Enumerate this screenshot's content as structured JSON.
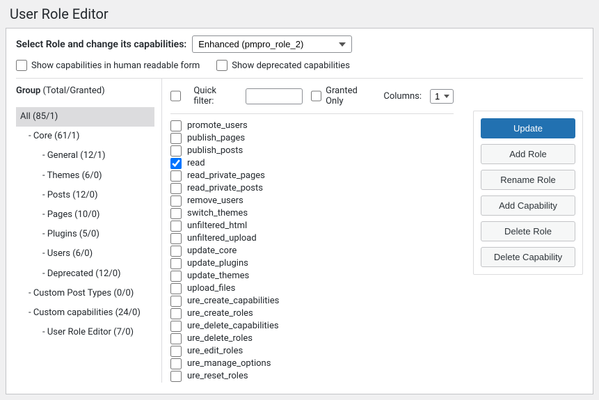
{
  "page_title": "User Role Editor",
  "select_role_label": "Select Role and change its capabilities:",
  "selected_role": "Enhanced (pmpro_role_2)",
  "human_readable_label": "Show capabilities in human readable form",
  "deprecated_label": "Show deprecated capabilities",
  "group_header_bold": "Group",
  "group_header_rest": "(Total/Granted)",
  "quick_filter_label": "Quick filter:",
  "granted_only_label": "Granted Only",
  "columns_label": "Columns:",
  "columns_value": "1",
  "groups": [
    {
      "label": "All (85/1)",
      "level": 0,
      "selected": true
    },
    {
      "label": "- Core (61/1)",
      "level": 1,
      "selected": false
    },
    {
      "label": "- General (12/1)",
      "level": 2,
      "selected": false
    },
    {
      "label": "- Themes (6/0)",
      "level": 2,
      "selected": false
    },
    {
      "label": "- Posts (12/0)",
      "level": 2,
      "selected": false
    },
    {
      "label": "- Pages (10/0)",
      "level": 2,
      "selected": false
    },
    {
      "label": "- Plugins (5/0)",
      "level": 2,
      "selected": false
    },
    {
      "label": "- Users (6/0)",
      "level": 2,
      "selected": false
    },
    {
      "label": "- Deprecated (12/0)",
      "level": 2,
      "selected": false
    },
    {
      "label": "- Custom Post Types (0/0)",
      "level": 1,
      "selected": false
    },
    {
      "label": "- Custom capabilities (24/0)",
      "level": 1,
      "selected": false
    },
    {
      "label": "- User Role Editor (7/0)",
      "level": 2,
      "selected": false
    }
  ],
  "capabilities": [
    {
      "name": "promote_users",
      "checked": false
    },
    {
      "name": "publish_pages",
      "checked": false
    },
    {
      "name": "publish_posts",
      "checked": false
    },
    {
      "name": "read",
      "checked": true
    },
    {
      "name": "read_private_pages",
      "checked": false
    },
    {
      "name": "read_private_posts",
      "checked": false
    },
    {
      "name": "remove_users",
      "checked": false
    },
    {
      "name": "switch_themes",
      "checked": false
    },
    {
      "name": "unfiltered_html",
      "checked": false
    },
    {
      "name": "unfiltered_upload",
      "checked": false
    },
    {
      "name": "update_core",
      "checked": false
    },
    {
      "name": "update_plugins",
      "checked": false
    },
    {
      "name": "update_themes",
      "checked": false
    },
    {
      "name": "upload_files",
      "checked": false
    },
    {
      "name": "ure_create_capabilities",
      "checked": false
    },
    {
      "name": "ure_create_roles",
      "checked": false
    },
    {
      "name": "ure_delete_capabilities",
      "checked": false
    },
    {
      "name": "ure_delete_roles",
      "checked": false
    },
    {
      "name": "ure_edit_roles",
      "checked": false
    },
    {
      "name": "ure_manage_options",
      "checked": false
    },
    {
      "name": "ure_reset_roles",
      "checked": false
    }
  ],
  "actions": {
    "update": "Update",
    "add_role": "Add Role",
    "rename_role": "Rename Role",
    "add_capability": "Add Capability",
    "delete_role": "Delete Role",
    "delete_capability": "Delete Capability"
  }
}
